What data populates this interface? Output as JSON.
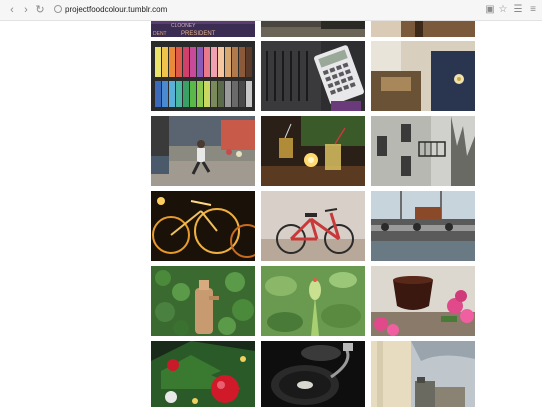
{
  "browser": {
    "url": "projectfoodcolour.tumblr.com",
    "back_icon": "back-arrow-icon",
    "forward_icon": "forward-arrow-icon",
    "reload_icon": "reload-icon",
    "site_icon": "site-info-icon",
    "translate_icon": "translate-icon",
    "bookmark_icon": "star-icon",
    "extension_icon": "extension-icon",
    "menu_icon": "menu-icon"
  },
  "gallery": {
    "photos": [
      {
        "subject": "clooney-poster",
        "text": [
          "CLOONEY",
          "PRESIDENT",
          "DENT"
        ]
      },
      {
        "subject": "table-top"
      },
      {
        "subject": "wooden-wall"
      },
      {
        "subject": "pastel-crayons"
      },
      {
        "subject": "calculator"
      },
      {
        "subject": "interior-brooch"
      },
      {
        "subject": "street-runner"
      },
      {
        "subject": "cocktails-candle"
      },
      {
        "subject": "building-balcony"
      },
      {
        "subject": "bicycles-night"
      },
      {
        "subject": "red-bicycle"
      },
      {
        "subject": "harbour-boat"
      },
      {
        "subject": "stone-fountain-ivy"
      },
      {
        "subject": "green-plant-bud"
      },
      {
        "subject": "bowl-pink-flowers"
      },
      {
        "subject": "christmas-tree"
      },
      {
        "subject": "record-player"
      },
      {
        "subject": "sky-building"
      }
    ]
  }
}
